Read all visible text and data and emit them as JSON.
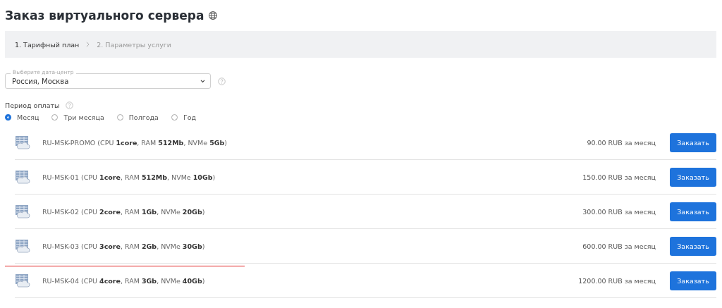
{
  "title": "Заказ виртуального сервера",
  "steps": [
    {
      "label": "1. Тарифный план",
      "selected": true
    },
    {
      "label": "2. Параметры услуги",
      "selected": false
    }
  ],
  "datacenter": {
    "label": "Выберите дата-центр",
    "value": "Россия, Москва"
  },
  "period": {
    "label": "Период оплаты",
    "options": [
      {
        "label": "Месяц",
        "selected": true
      },
      {
        "label": "Три месяца",
        "selected": false
      },
      {
        "label": "Полгода",
        "selected": false
      },
      {
        "label": "Год",
        "selected": false
      }
    ]
  },
  "plans": [
    {
      "name": "RU-MSK-PROMO (CPU **1core**, RAM **512Mb**, NVMe **5Gb**)",
      "price": "90.00 RUB за месяц",
      "button": "Заказать",
      "underlined": false
    },
    {
      "name": "RU-MSK-01 (CPU **1core**, RAM **512Mb**, NVMe **10Gb**)",
      "price": "150.00 RUB за месяц",
      "button": "Заказать",
      "underlined": false
    },
    {
      "name": "RU-MSK-02 (CPU **2core**, RAM **1Gb**, NVMe **20Gb**)",
      "price": "300.00 RUB за месяц",
      "button": "Заказать",
      "underlined": false
    },
    {
      "name": "RU-MSK-03 (CPU **3core**, RAM **2Gb**, NVMe **30Gb**)",
      "price": "600.00 RUB за месяц",
      "button": "Заказать",
      "underlined": true
    },
    {
      "name": "RU-MSK-04 (CPU **4core**, RAM **3Gb**, NVMe **40Gb**)",
      "price": "1200.00 RUB за месяц",
      "button": "Заказать",
      "underlined": false
    }
  ]
}
